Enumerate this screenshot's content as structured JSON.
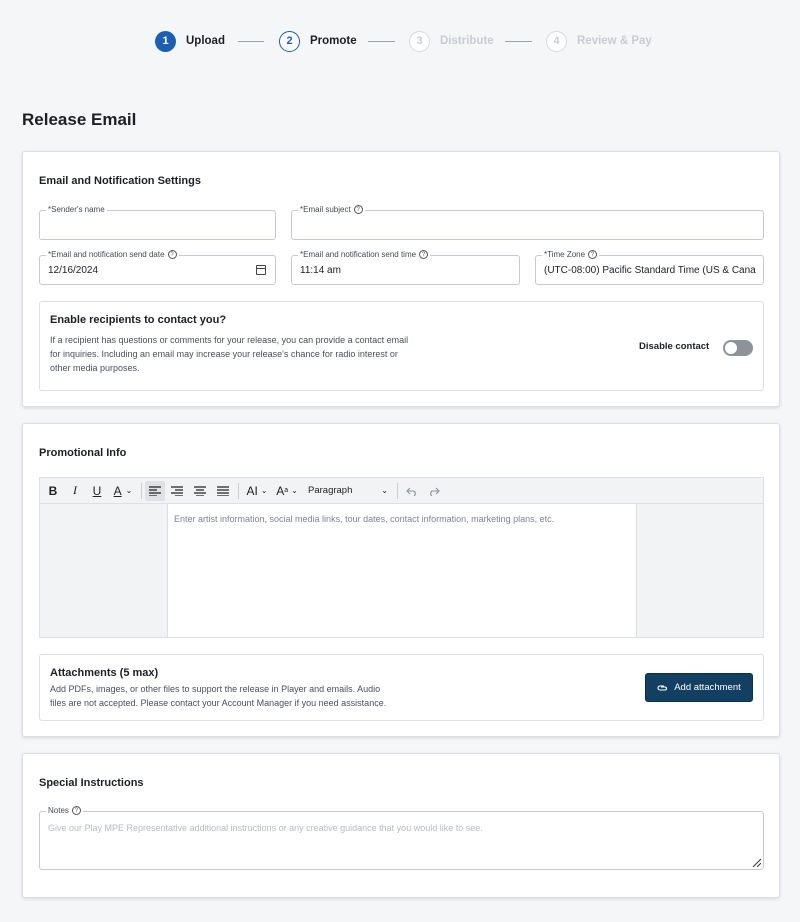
{
  "stepper": {
    "steps": [
      {
        "num": "1",
        "label": "Upload"
      },
      {
        "num": "2",
        "label": "Promote"
      },
      {
        "num": "3",
        "label": "Distribute"
      },
      {
        "num": "4",
        "label": "Review & Pay"
      }
    ]
  },
  "page_title": "Release Email",
  "email_settings": {
    "title": "Email and Notification Settings",
    "sender_name": {
      "label": "*Sender's name",
      "value": ""
    },
    "email_subject": {
      "label": "*Email subject",
      "value": ""
    },
    "send_date": {
      "label": "*Email and notification send date",
      "value": "12/16/2024"
    },
    "send_time": {
      "label": "*Email and notification send time",
      "value": "11:14 am"
    },
    "time_zone": {
      "label": "*Time Zone",
      "value": "(UTC-08:00) Pacific Standard Time (US & Canad"
    },
    "contact": {
      "title": "Enable recipients to contact you?",
      "line1": "If a recipient has questions or comments for your release, you can provide a contact email",
      "line2": "for inquiries. Including an email may increase your release's chance for radio interest or",
      "line3": "other media purposes.",
      "toggle_label": "Disable contact"
    }
  },
  "promotional": {
    "title": "Promotional Info",
    "toolbar": {
      "bold": "B",
      "italic": "I",
      "underline": "U",
      "font_color": "A",
      "font_size": "AI",
      "font_style": "A",
      "paragraph": "Paragraph"
    },
    "editor_placeholder": "Enter artist information, social media links, tour dates, contact information, marketing plans, etc.",
    "attachments": {
      "title": "Attachments (5 max)",
      "line1": "Add PDFs, images, or other files to support the release in Player and emails. Audio",
      "line2": "files are not accepted. Please contact your Account Manager if you need assistance.",
      "button": "Add attachment"
    }
  },
  "special": {
    "title": "Special Instructions",
    "notes_label": "Notes",
    "notes_placeholder": "Give our Play MPE Representative additional instructions or any creative guidance that you would like to see."
  },
  "icons": {
    "help": "question-circle-icon",
    "calendar": "calendar-icon",
    "paperclip": "paperclip-icon"
  },
  "colors": {
    "accent": "#1a5fb4",
    "primary_button": "#133f63"
  }
}
